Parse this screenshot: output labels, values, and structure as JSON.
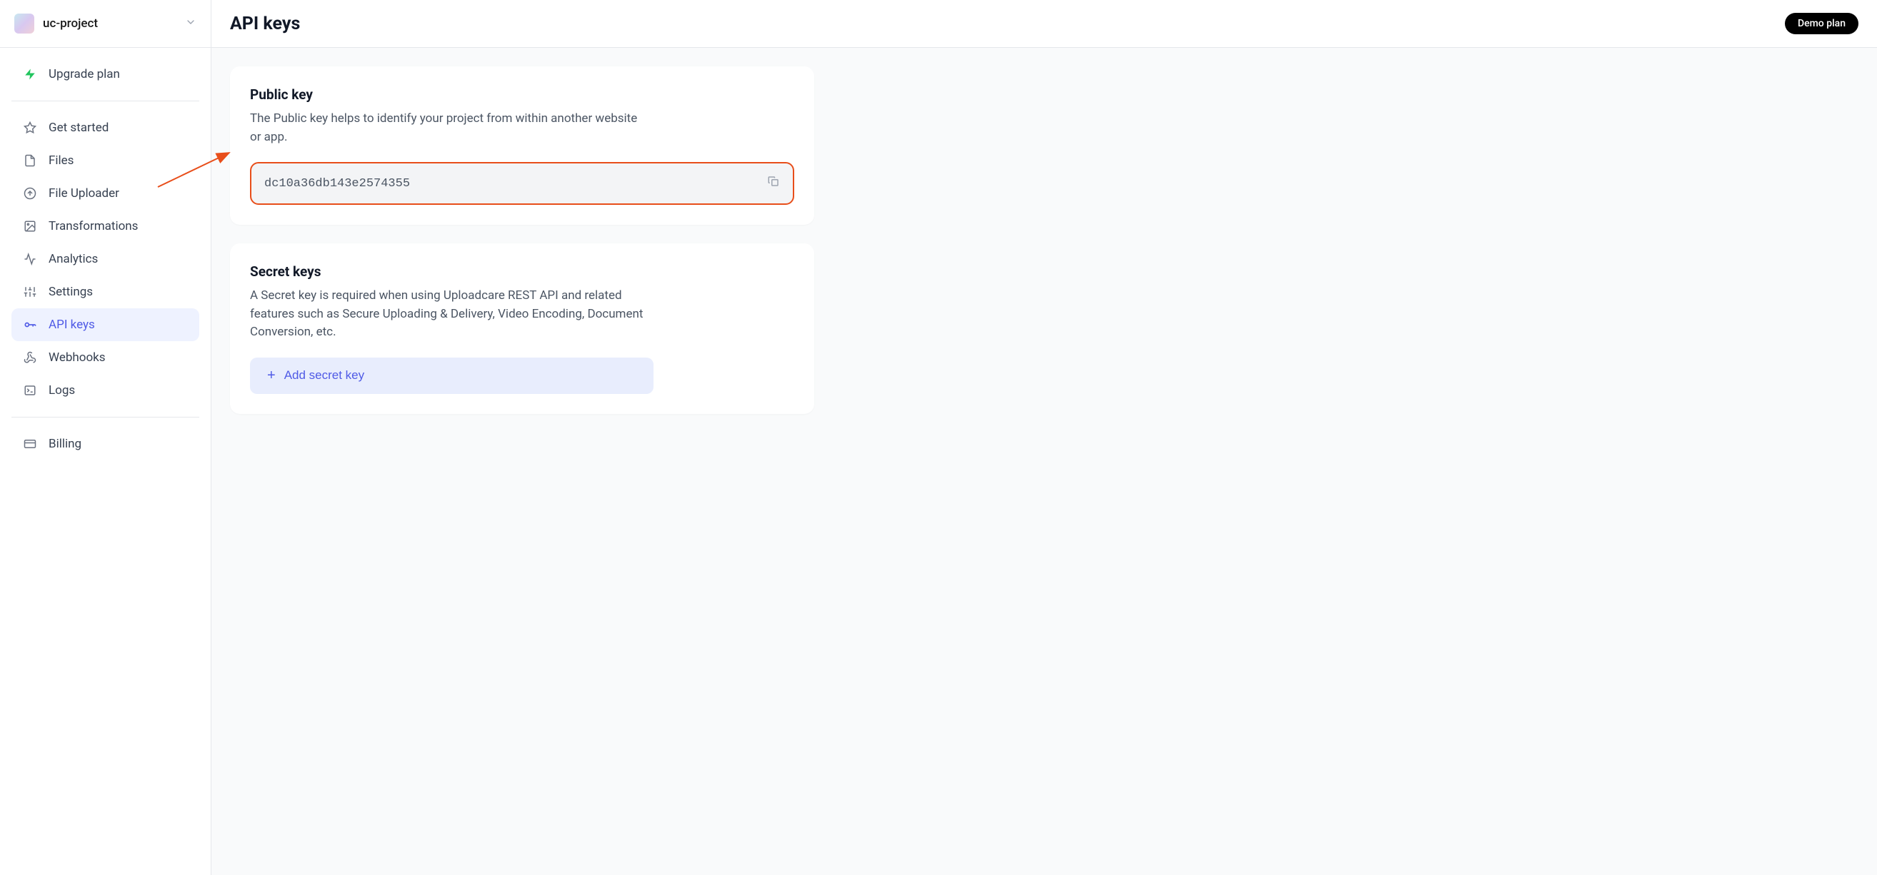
{
  "project": {
    "name": "uc-project"
  },
  "sidebar": {
    "upgrade": {
      "label": "Upgrade plan"
    },
    "items": [
      {
        "id": "get-started",
        "label": "Get started",
        "icon": "star"
      },
      {
        "id": "files",
        "label": "Files",
        "icon": "file"
      },
      {
        "id": "file-uploader",
        "label": "File Uploader",
        "icon": "upload"
      },
      {
        "id": "transformations",
        "label": "Transformations",
        "icon": "image"
      },
      {
        "id": "analytics",
        "label": "Analytics",
        "icon": "activity"
      },
      {
        "id": "settings",
        "label": "Settings",
        "icon": "sliders"
      },
      {
        "id": "api-keys",
        "label": "API keys",
        "icon": "key",
        "active": true
      },
      {
        "id": "webhooks",
        "label": "Webhooks",
        "icon": "webhook"
      },
      {
        "id": "logs",
        "label": "Logs",
        "icon": "terminal"
      }
    ],
    "billing": {
      "label": "Billing"
    }
  },
  "header": {
    "title": "API keys",
    "plan_badge": "Demo plan"
  },
  "public_key": {
    "title": "Public key",
    "description": "The Public key helps to identify your project from within another website or app.",
    "value": "dc10a36db143e2574355"
  },
  "secret_keys": {
    "title": "Secret keys",
    "description": "A Secret key is required when using Uploadcare REST API and related features such as Secure Uploading & Delivery, Video Encoding, Document Conversion, etc.",
    "add_label": "Add secret key"
  }
}
